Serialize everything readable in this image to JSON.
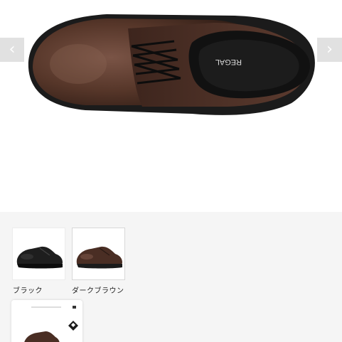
{
  "gallery": {
    "prev_glyph": "‹",
    "next_glyph": "›",
    "main_image": "dark-brown-leather-shoe-top-view",
    "brand_insole_text": "REGAL"
  },
  "colors": {
    "swatches": [
      {
        "label": "ブラック",
        "image": "black-shoe-icon",
        "selected": false
      },
      {
        "label": "ダークブラウン",
        "image": "dark-brown-shoe-icon",
        "selected": true
      }
    ]
  },
  "thumbnail": {
    "image": "shoe-box-thumbnail"
  },
  "palette": {
    "leather": "#4a2e24",
    "leather_highlight": "#7a5446",
    "sole": "#1b1b1b",
    "insole": "#111111",
    "background": "#f5f5f5"
  }
}
